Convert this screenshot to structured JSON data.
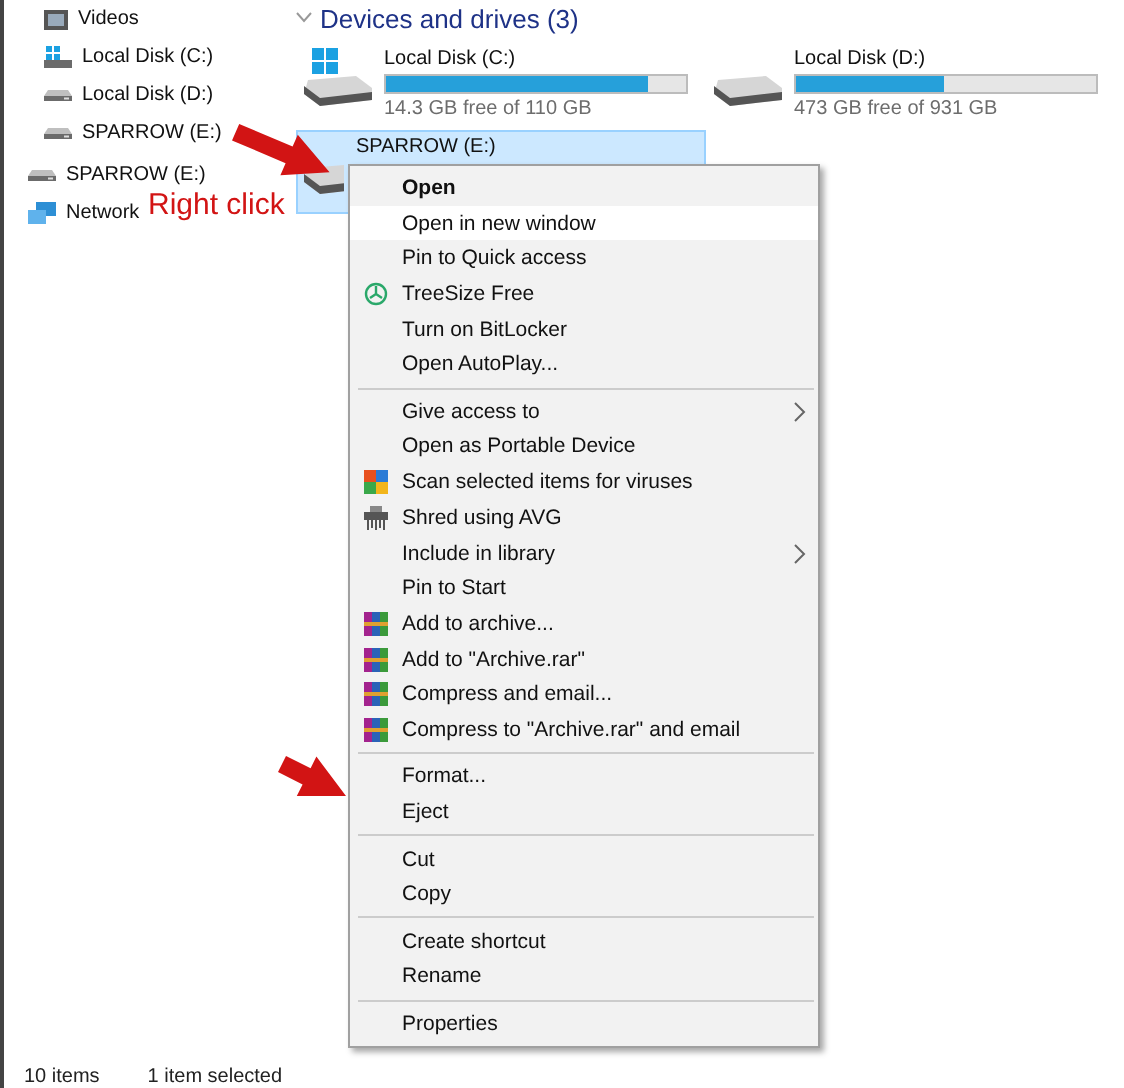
{
  "nav": {
    "nested_items": [
      {
        "label": "Videos",
        "kind": "videos"
      },
      {
        "label": "Local Disk (C:)",
        "kind": "system-drive"
      },
      {
        "label": "Local Disk (D:)",
        "kind": "drive"
      },
      {
        "label": "SPARROW (E:)",
        "kind": "drive"
      }
    ],
    "items": [
      {
        "label": "SPARROW (E:)",
        "kind": "drive"
      },
      {
        "label": "Network",
        "kind": "network"
      }
    ]
  },
  "section": {
    "title": "Devices and drives (3)"
  },
  "drives": [
    {
      "name": "Local Disk (C:)",
      "kind": "system",
      "level": 0.87,
      "free": "14.3 GB free of 110 GB",
      "selected": false
    },
    {
      "name": "Local Disk (D:)",
      "kind": "plain",
      "level": 0.49,
      "free": "473 GB free of 931 GB",
      "selected": false
    },
    {
      "name": "SPARROW (E:)",
      "kind": "removable",
      "selected": true
    }
  ],
  "context_menu": {
    "groups": [
      [
        {
          "label": "Open",
          "kind": "plain",
          "bold": true,
          "highlighted": false,
          "submenu": false
        },
        {
          "label": "Open in new window",
          "kind": "plain",
          "bold": false,
          "highlighted": true,
          "submenu": false
        },
        {
          "label": "Pin to Quick access",
          "kind": "plain",
          "bold": false,
          "highlighted": false,
          "submenu": false
        },
        {
          "label": "TreeSize Free",
          "kind": "treesize",
          "bold": false,
          "highlighted": false,
          "submenu": false
        },
        {
          "label": "Turn on BitLocker",
          "kind": "plain",
          "bold": false,
          "highlighted": false,
          "submenu": false
        },
        {
          "label": "Open AutoPlay...",
          "kind": "plain",
          "bold": false,
          "highlighted": false,
          "submenu": false
        }
      ],
      [
        {
          "label": "Give access to",
          "kind": "plain",
          "bold": false,
          "highlighted": false,
          "submenu": true
        },
        {
          "label": "Open as Portable Device",
          "kind": "plain",
          "bold": false,
          "highlighted": false,
          "submenu": false
        },
        {
          "label": "Scan selected items for viruses",
          "kind": "scan",
          "bold": false,
          "highlighted": false,
          "submenu": false
        },
        {
          "label": "Shred using AVG",
          "kind": "shred",
          "bold": false,
          "highlighted": false,
          "submenu": false
        },
        {
          "label": "Include in library",
          "kind": "plain",
          "bold": false,
          "highlighted": false,
          "submenu": true
        },
        {
          "label": "Pin to Start",
          "kind": "plain",
          "bold": false,
          "highlighted": false,
          "submenu": false
        },
        {
          "label": "Add to archive...",
          "kind": "archive",
          "bold": false,
          "highlighted": false,
          "submenu": false
        },
        {
          "label": "Add to \"Archive.rar\"",
          "kind": "archive",
          "bold": false,
          "highlighted": false,
          "submenu": false
        },
        {
          "label": "Compress and email...",
          "kind": "archive",
          "bold": false,
          "highlighted": false,
          "submenu": false
        },
        {
          "label": "Compress to \"Archive.rar\" and email",
          "kind": "archive",
          "bold": false,
          "highlighted": false,
          "submenu": false
        }
      ],
      [
        {
          "label": "Format...",
          "kind": "plain",
          "bold": false,
          "highlighted": false,
          "submenu": false
        },
        {
          "label": "Eject",
          "kind": "plain",
          "bold": false,
          "highlighted": false,
          "submenu": false
        }
      ],
      [
        {
          "label": "Cut",
          "kind": "plain",
          "bold": false,
          "highlighted": false,
          "submenu": false
        },
        {
          "label": "Copy",
          "kind": "plain",
          "bold": false,
          "highlighted": false,
          "submenu": false
        }
      ],
      [
        {
          "label": "Create shortcut",
          "kind": "plain",
          "bold": false,
          "highlighted": false,
          "submenu": false
        },
        {
          "label": "Rename",
          "kind": "plain",
          "bold": false,
          "highlighted": false,
          "submenu": false
        }
      ],
      [
        {
          "label": "Properties",
          "kind": "plain",
          "bold": false,
          "highlighted": false,
          "submenu": false
        }
      ]
    ]
  },
  "annotations": {
    "label": "Right click"
  },
  "status_bar": {
    "count": "10 items",
    "selection": "1 item selected"
  }
}
